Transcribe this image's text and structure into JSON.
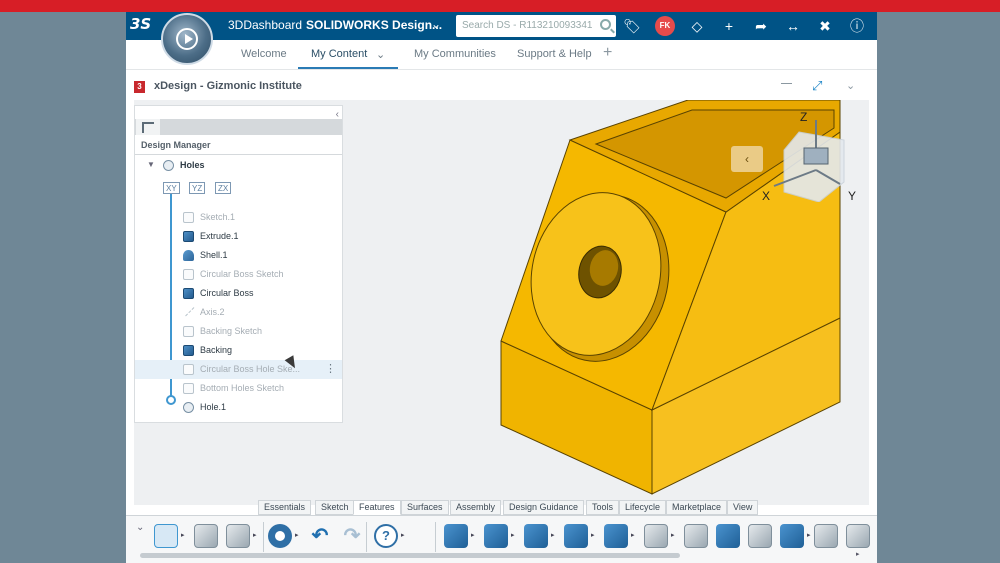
{
  "topbar": {
    "platform": "3DDashboard",
    "app_name": "SOLIDWORKS Design...",
    "search_placeholder": "Search DS - R113210093341",
    "avatar_initials": "FK"
  },
  "tabs": [
    {
      "label": "Welcome"
    },
    {
      "label": "My Content"
    },
    {
      "label": "My Communities"
    },
    {
      "label": "Support & Help"
    }
  ],
  "app_header": {
    "title": "xDesign - Gizmonic Institute"
  },
  "tree": {
    "panel_title": "Design Manager",
    "root": "Holes",
    "planes": [
      "XY",
      "YZ",
      "ZX"
    ],
    "items": [
      {
        "label": "Sketch.1"
      },
      {
        "label": "Extrude.1"
      },
      {
        "label": "Shell.1"
      },
      {
        "label": "Circular Boss Sketch"
      },
      {
        "label": "Circular Boss"
      },
      {
        "label": "Axis.2"
      },
      {
        "label": "Backing Sketch"
      },
      {
        "label": "Backing"
      },
      {
        "label": "Circular Boss Hole Ske..."
      },
      {
        "label": "Bottom Holes Sketch"
      },
      {
        "label": "Hole.1"
      }
    ]
  },
  "viewcube": {
    "axis_z": "Z",
    "axis_x": "X",
    "axis_y": "Y"
  },
  "ribbon": {
    "tabs": [
      "Essentials",
      "Sketch",
      "Features",
      "Surfaces",
      "Assembly",
      "Design Guidance",
      "Tools",
      "Lifecycle",
      "Marketplace",
      "View"
    ],
    "active_tab": "Features"
  },
  "colors": {
    "topbar": "#005386",
    "part_face": "#f5b800",
    "accent": "#3f97d0",
    "brand_red": "#d71e26"
  }
}
